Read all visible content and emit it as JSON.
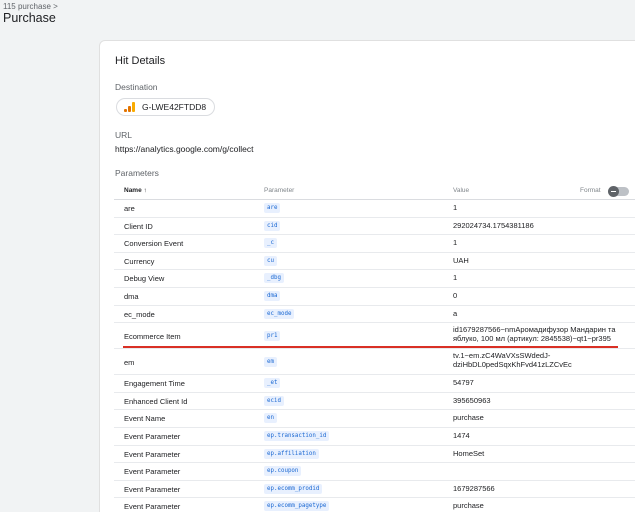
{
  "header": {
    "breadcrumb": "115 purchase >",
    "title": "Purchase"
  },
  "hit_details": {
    "title": "Hit Details",
    "destination_label": "Destination",
    "destination_id": "G-LWE42FTDD8",
    "url_label": "URL",
    "url": "https://analytics.google.com/g/collect",
    "parameters_label": "Parameters"
  },
  "table": {
    "col_name": "Name ↑",
    "col_parameter": "Parameter",
    "col_value": "Value",
    "format_label": "Format",
    "rows": [
      {
        "name": "are",
        "param": "are",
        "value": "1"
      },
      {
        "name": "Client ID",
        "param": "cid",
        "value": "292024734.1754381186"
      },
      {
        "name": "Conversion Event",
        "param": "_c",
        "value": "1"
      },
      {
        "name": "Currency",
        "param": "cu",
        "value": "UAH"
      },
      {
        "name": "Debug View",
        "param": "_dbg",
        "value": "1"
      },
      {
        "name": "dma",
        "param": "dma",
        "value": "0"
      },
      {
        "name": "ec_mode",
        "param": "ec_mode",
        "value": "a"
      },
      {
        "name": "Ecommerce Item",
        "param": "pr1",
        "value": "id1679287566~nmАромадифузор Мандарин та яблуко, 100 мл (артикул: 2845538)~qt1~pr395"
      },
      {
        "name": "em",
        "param": "em",
        "value": "tv.1~em.zC4WaVXsSWdedJ-dziHbDL0pedSqxKhFvd41zLZCvEc"
      },
      {
        "name": "Engagement Time",
        "param": "_et",
        "value": "54797"
      },
      {
        "name": "Enhanced Client Id",
        "param": "ecid",
        "value": "395650963"
      },
      {
        "name": "Event Name",
        "param": "en",
        "value": "purchase"
      },
      {
        "name": "Event Parameter",
        "param": "ep.transaction_id",
        "value": "1474"
      },
      {
        "name": "Event Parameter",
        "param": "ep.affiliation",
        "value": "HomeSet"
      },
      {
        "name": "Event Parameter",
        "param": "ep.coupon",
        "value": ""
      },
      {
        "name": "Event Parameter",
        "param": "ep.ecomm_prodid",
        "value": "1679287566"
      },
      {
        "name": "Event Parameter",
        "param": "ep.ecomm_pagetype",
        "value": "purchase"
      }
    ]
  },
  "colors": {
    "highlight_underline": "#d93025",
    "param_chip_text": "#1967d2",
    "param_chip_bg": "#e8f0fe"
  }
}
